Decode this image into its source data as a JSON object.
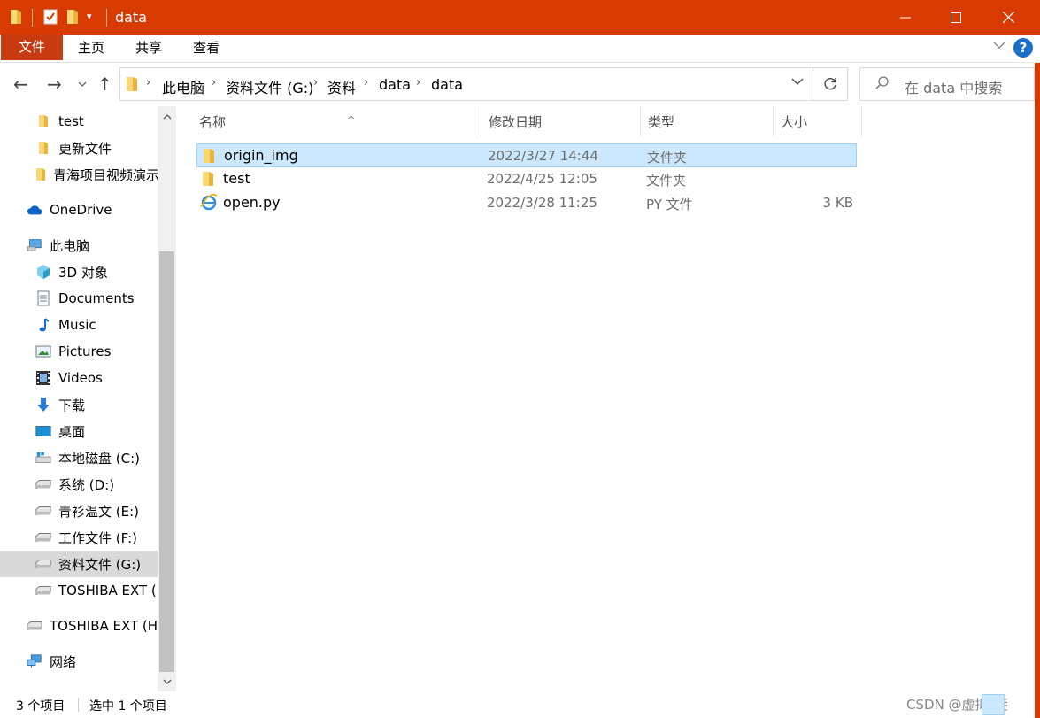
{
  "window": {
    "title": "data",
    "minimize": "—",
    "maximize": "☐",
    "close": "✕"
  },
  "ribbon": {
    "file_tab": "文件",
    "tabs": [
      "主页",
      "共享",
      "查看"
    ],
    "help": "?"
  },
  "nav": {
    "back": "←",
    "forward": "→",
    "recent": "⌄",
    "up": "↑",
    "breadcrumbs": [
      "此电脑",
      "资料文件 (G:)",
      "资料",
      "data",
      "data"
    ],
    "search_placeholder": "在 data 中搜索"
  },
  "sidebar": {
    "items": [
      {
        "label": "test",
        "icon": "folder-icon"
      },
      {
        "label": "更新文件",
        "icon": "folder-icon"
      },
      {
        "label": "青海项目视频演示",
        "icon": "folder-icon"
      },
      {
        "label": "OneDrive",
        "icon": "onedrive-icon"
      },
      {
        "label": "此电脑",
        "icon": "this-pc-icon"
      },
      {
        "label": "3D 对象",
        "icon": "3d-objects-icon"
      },
      {
        "label": "Documents",
        "icon": "documents-icon"
      },
      {
        "label": "Music",
        "icon": "music-icon"
      },
      {
        "label": "Pictures",
        "icon": "pictures-icon"
      },
      {
        "label": "Videos",
        "icon": "videos-icon"
      },
      {
        "label": "下载",
        "icon": "download-icon"
      },
      {
        "label": "桌面",
        "icon": "desktop-icon"
      },
      {
        "label": "本地磁盘 (C:)",
        "icon": "windows-drive-icon"
      },
      {
        "label": "系统 (D:)",
        "icon": "drive-icon"
      },
      {
        "label": "青衫温文 (E:)",
        "icon": "drive-icon"
      },
      {
        "label": "工作文件 (F:)",
        "icon": "drive-icon"
      },
      {
        "label": "资料文件 (G:)",
        "icon": "drive-icon"
      },
      {
        "label": "TOSHIBA EXT (H:)",
        "icon": "drive-icon"
      },
      {
        "label": "TOSHIBA EXT (H:)",
        "icon": "drive-icon"
      },
      {
        "label": "网络",
        "icon": "network-icon"
      }
    ]
  },
  "columns": {
    "name": "名称",
    "date": "修改日期",
    "type": "类型",
    "size": "大小"
  },
  "files": [
    {
      "name": "origin_img",
      "date": "2022/3/27 14:44",
      "type": "文件夹",
      "size": "",
      "icon": "folder-icon"
    },
    {
      "name": "test",
      "date": "2022/4/25 12:05",
      "type": "文件夹",
      "size": "",
      "icon": "folder-icon"
    },
    {
      "name": "open.py",
      "date": "2022/3/28 11:25",
      "type": "PY 文件",
      "size": "3 KB",
      "icon": "ie-file-icon"
    }
  ],
  "status": {
    "count": "3 个项目",
    "selected": "选中 1 个项目",
    "watermark": "CSDN @虚拟打手"
  },
  "colors": {
    "titlebar": "#d83b01",
    "selection": "#cce8ff",
    "folder": "#f3c64b"
  }
}
